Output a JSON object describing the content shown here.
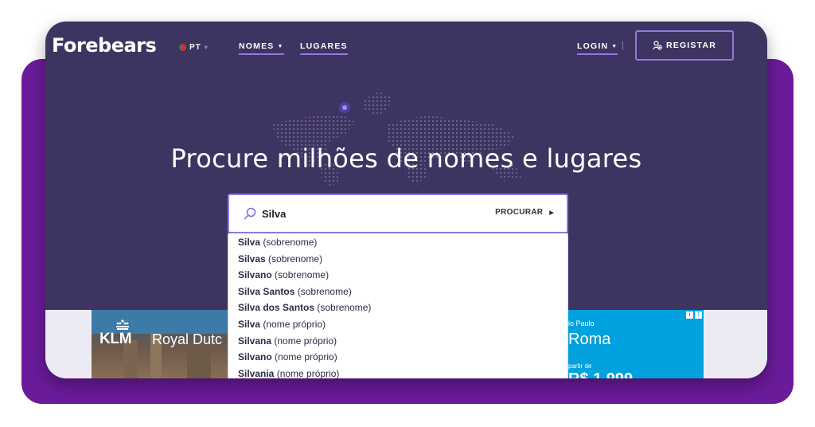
{
  "header": {
    "logo": "Forebears",
    "language": "PT",
    "nav": [
      {
        "label": "NOMES"
      },
      {
        "label": "LUGARES"
      }
    ],
    "login_label": "LOGIN",
    "register_label": "REGISTAR"
  },
  "hero": {
    "title": "Procure milhões de nomes e lugares"
  },
  "search": {
    "value": "Silva",
    "button_label": "PROCURAR"
  },
  "suggestions": [
    {
      "name": "Silva",
      "type": "(sobrenome)"
    },
    {
      "name": "Silvas",
      "type": "(sobrenome)"
    },
    {
      "name": "Silvano",
      "type": "(sobrenome)"
    },
    {
      "name": "Silva Santos",
      "type": "(sobrenome)"
    },
    {
      "name": "Silva dos Santos",
      "type": "(sobrenome)"
    },
    {
      "name": "Silva",
      "type": "(nome próprio)"
    },
    {
      "name": "Silvana",
      "type": "(nome próprio)"
    },
    {
      "name": "Silvano",
      "type": "(nome próprio)"
    },
    {
      "name": "Silvania",
      "type": "(nome próprio)"
    }
  ],
  "ads": {
    "left": {
      "brand": "KLM",
      "text": "Royal Dutc"
    },
    "right": {
      "line1": "io Paulo",
      "line2": "Roma",
      "line3": "partir de",
      "line4": "R$ 1.999"
    }
  },
  "colors": {
    "outer_purple": "#6a1b9a",
    "header_bg": "#3e3461",
    "accent": "#8f7be0",
    "band": "#ecebf3",
    "ad_blue": "#00a1de"
  }
}
